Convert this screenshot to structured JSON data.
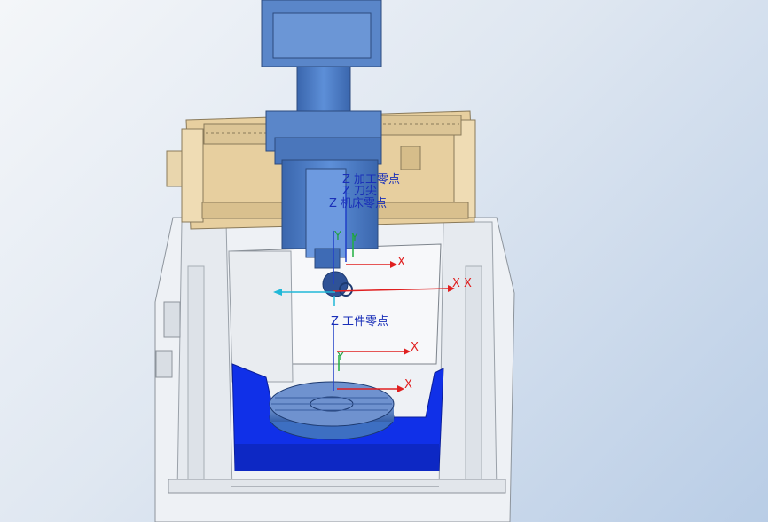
{
  "scene": {
    "labels": {
      "machining_zero": "Z 加工零点",
      "tool_tip": "Z 刀尖",
      "machine_zero": "Z 机床零点",
      "workpiece_zero": "Z 工件零点",
      "y": "Y",
      "x": "X",
      "xx": "X X"
    },
    "colors": {
      "background_top": "#f4f6f9",
      "background_bottom": "#b9cde6",
      "spindle": "#4f7fc7",
      "gantry": "#e7cf9f",
      "enclosure": "#f1f4f7",
      "table_base": "#1030e8",
      "rotary_table": "#3d6fc2",
      "x_axis": "#e02020",
      "y_axis": "#20b040",
      "z_axis": "#2040c8",
      "cyan_axis": "#20b8d8"
    }
  }
}
